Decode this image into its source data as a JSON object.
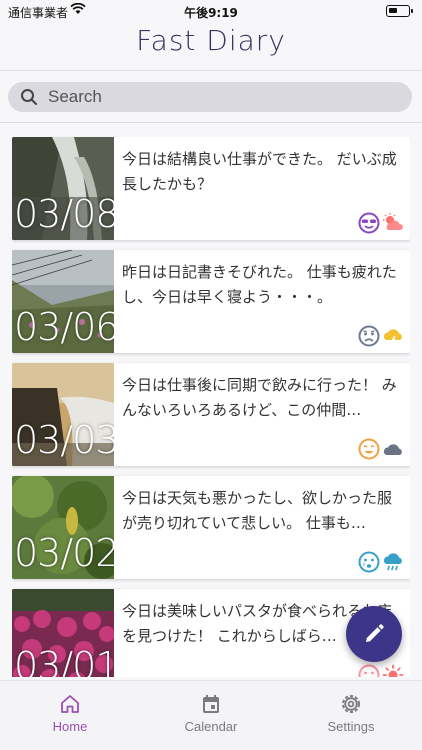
{
  "status_bar": {
    "carrier": "通信事業者",
    "time": "午後9:19"
  },
  "app": {
    "title": "Fast Diary"
  },
  "search": {
    "placeholder": "Search"
  },
  "entries": [
    {
      "date": "03/08",
      "text": "今日は結構良い仕事ができた。 だいぶ成長したかも？",
      "mood": "cool-face-icon",
      "weather": "partly-cloudy-icon",
      "mood_color": "#8a44c8",
      "weather_color": "#ff6f6f"
    },
    {
      "date": "03/06",
      "text": "昨日は日記書きそびれた。 仕事も疲れたし、今日は早く寝よう・・・。",
      "mood": "sad-face-icon",
      "weather": "thunder-cloud-icon",
      "mood_color": "#6b7a8f",
      "weather_color": "#f2c230"
    },
    {
      "date": "03/03",
      "text": "今日は仕事後に同期で飲みに行った！ みんないろいろあるけど、この仲間…",
      "mood": "happy-face-icon",
      "weather": "cloud-icon",
      "mood_color": "#f0a040",
      "weather_color": "#6b7385"
    },
    {
      "date": "03/02",
      "text": "今日は天気も悪かったし、欲しかった服が売り切れていて悲しい。 仕事も…",
      "mood": "crying-face-icon",
      "weather": "rain-cloud-icon",
      "mood_color": "#36a0c8",
      "weather_color": "#36a0c8"
    },
    {
      "date": "03/01",
      "text": "今日は美味しいパスタが食べられるお店を見つけた！ これからしばら…",
      "mood": "smile-face-icon",
      "weather": "sunny-icon",
      "mood_color": "#ff8fa0",
      "weather_color": "#ff6f6f"
    }
  ],
  "tabs": [
    {
      "label": "Home",
      "icon": "home-icon",
      "active": true
    },
    {
      "label": "Calendar",
      "icon": "calendar-icon",
      "active": false
    },
    {
      "label": "Settings",
      "icon": "gear-icon",
      "active": false
    }
  ],
  "colors": {
    "accent": "#3d3588",
    "active_tab": "#9a4fb4",
    "title": "#3a2f63"
  }
}
